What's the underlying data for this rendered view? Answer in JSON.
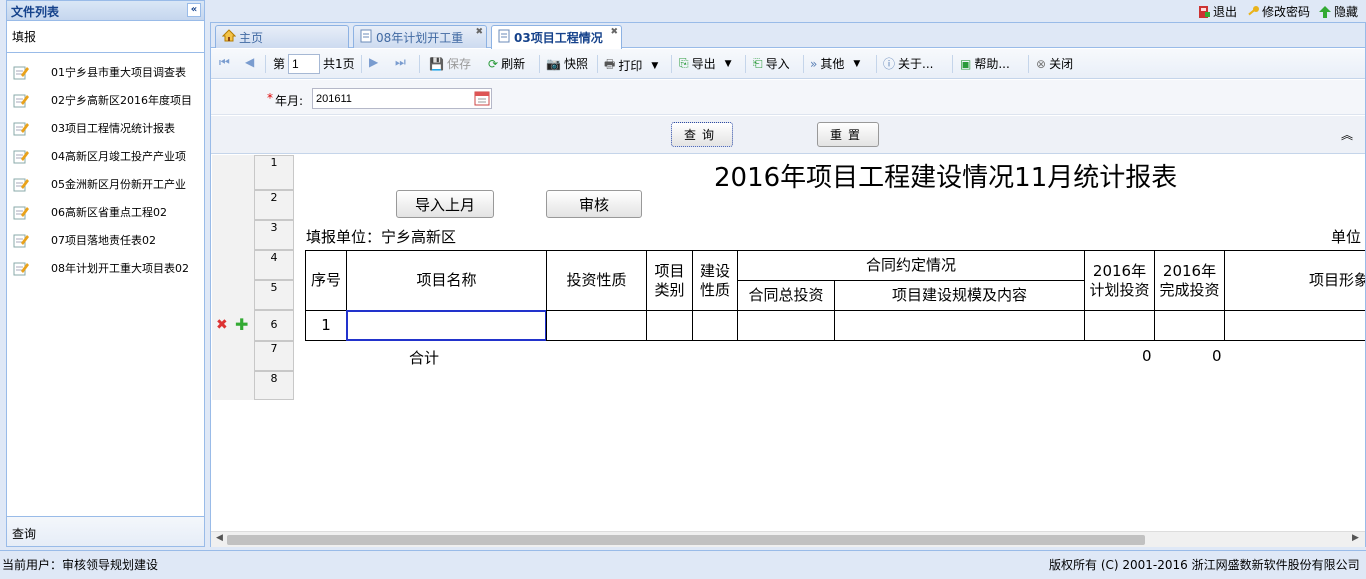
{
  "topbar": {
    "logout": "退出",
    "change_password": "修改密码",
    "hide": "隐藏"
  },
  "sidebar": {
    "title": "文件列表",
    "section_fill": "填报",
    "items": [
      {
        "label": "01宁乡县市重大项目调查表"
      },
      {
        "label": "02宁乡高新区2016年度项目"
      },
      {
        "label": "03项目工程情况统计报表"
      },
      {
        "label": "04高新区月竣工投产产业项"
      },
      {
        "label": "05金洲新区月份新开工产业"
      },
      {
        "label": "06高新区省重点工程02"
      },
      {
        "label": "07项目落地责任表02"
      },
      {
        "label": "08年计划开工重大项目表02"
      }
    ],
    "section_query": "查询"
  },
  "tabs": [
    {
      "label": "主页"
    },
    {
      "label": "08年计划开工重"
    },
    {
      "label": "03项目工程情况"
    }
  ],
  "toolbar": {
    "page_prefix": "第",
    "page_value": "1",
    "page_total": "共1页",
    "save": "保存",
    "refresh": "刷新",
    "snapshot": "快照",
    "print": "打印",
    "export": "导出",
    "import": "导入",
    "other": "其他",
    "about": "关于...",
    "help": "帮助...",
    "close": "关闭"
  },
  "filter": {
    "label": "年月:",
    "value": "201611"
  },
  "buttons": {
    "query": "查询",
    "reset": "重置"
  },
  "report": {
    "title": "2016年项目工程建设情况11月统计报表",
    "import_prev": "导入上月",
    "audit": "审核",
    "unit_label": "填报单位：宁乡高新区",
    "unit_right": "单位",
    "row_numbers": [
      "1",
      "2",
      "3",
      "4",
      "5",
      "6",
      "7",
      "8"
    ],
    "headers": {
      "seq": "序号",
      "name": "项目名称",
      "nature": "投资性质",
      "category": "项目类别",
      "build_nature": "建设性质",
      "contract": "合同约定情况",
      "contract_total": "合同总投资",
      "contract_scope": "项目建设规模及内容",
      "plan_2016": "2016年计划投资",
      "done_2016": "2016年完成投资",
      "progress": "项目形象"
    },
    "row1_seq": "1",
    "total_label": "合计",
    "total_plan": "0",
    "total_done": "0"
  },
  "status": {
    "current_user": "当前用户：审核领导规划建设",
    "copyright": "版权所有 (C) 2001-2016 浙江网盛数新软件股份有限公司"
  },
  "colors": {
    "panel_border": "#99bbe8",
    "header_text": "#15428b",
    "delete": "#d33",
    "add": "#3a3"
  }
}
